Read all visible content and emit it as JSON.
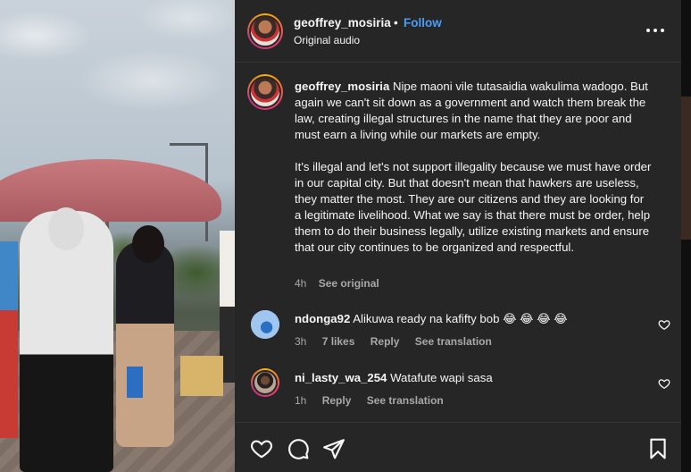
{
  "post": {
    "username": "geoffrey_mosiria",
    "separator": "•",
    "follow_label": "Follow",
    "audio_label": "Original audio"
  },
  "caption": {
    "username": "geoffrey_mosiria",
    "paragraph1": "Nipe maoni vile tutasaidia wakulima wadogo. But again we can't sit down as a government and watch them break the law, creating illegal structures in the name that they are poor and must earn a living while our markets are empty.",
    "paragraph2": "It's illegal and let's not support illegality because we must have order in our capital city. But that doesn't mean that hawkers are useless, they matter the most. They are our citizens and they are looking for a legitimate livelihood. What we say is that there must be order, help them to do their business legally, utilize existing markets and ensure that our city continues to be organized and respectful.",
    "time": "4h",
    "see_original": "See original"
  },
  "comments": [
    {
      "username": "ndonga92",
      "text": "Alikuwa ready na kafifty bob 😂 😂 😂 😂",
      "time": "3h",
      "likes": "7 likes",
      "reply": "Reply",
      "translate": "See translation"
    },
    {
      "username": "ni_lasty_wa_254",
      "text": "Watafute wapi sasa",
      "time": "1h",
      "reply": "Reply",
      "translate": "See translation"
    }
  ],
  "icons": {
    "more": "more-options-icon",
    "like": "heart-icon",
    "comment": "comment-icon",
    "share": "share-icon",
    "save": "bookmark-icon"
  },
  "colors": {
    "panel_bg": "#262626",
    "link_blue": "#4a9cf5",
    "text": "#f5f5f5",
    "muted": "#a8a8a8"
  }
}
